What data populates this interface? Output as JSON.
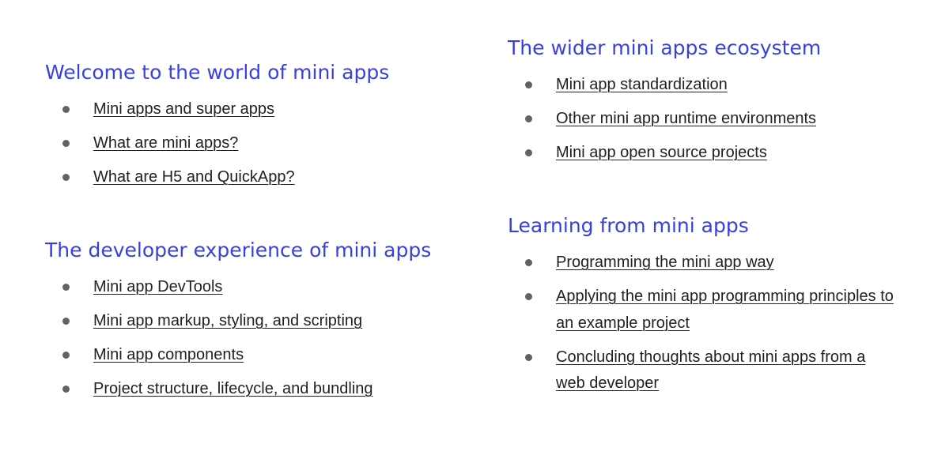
{
  "sections": {
    "welcome": {
      "title": "Welcome to the world of mini apps",
      "links": [
        "Mini apps and super apps",
        "What are mini apps?",
        "What are H5 and QuickApp?"
      ]
    },
    "developer": {
      "title": "The developer experience of mini apps",
      "links": [
        "Mini app DevTools",
        "Mini app markup, styling, and scripting",
        "Mini app components",
        "Project structure, lifecycle, and bundling"
      ]
    },
    "ecosystem": {
      "title": "The wider mini apps ecosystem",
      "links": [
        "Mini app standardization",
        "Other mini app runtime environments",
        "Mini app open source projects"
      ]
    },
    "learning": {
      "title": "Learning from mini apps",
      "links": [
        "Programming the mini app way",
        "Applying the mini app programming principles to an example project",
        "Concluding thoughts about mini apps from a web developer"
      ]
    }
  },
  "colors": {
    "heading": "#3740e0",
    "link_text": "#202124",
    "bullet": "#5f6368"
  }
}
